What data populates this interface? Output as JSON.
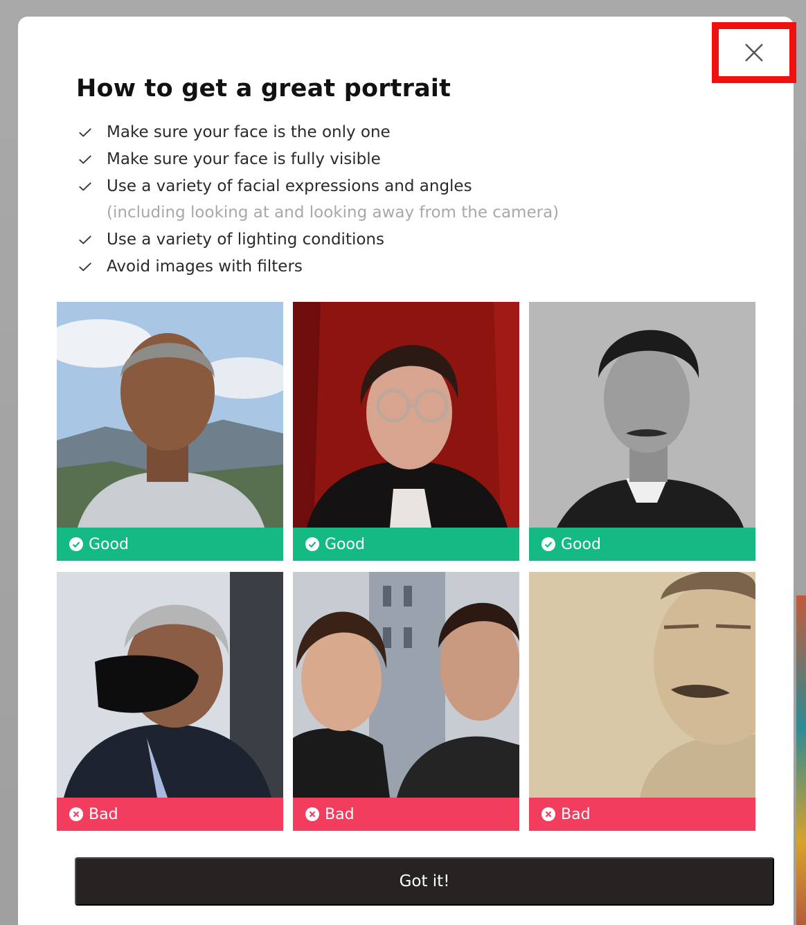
{
  "modal": {
    "title": "How to get a great portrait",
    "close_icon": "close-icon",
    "tips": [
      {
        "text": "Make sure your face is the only one"
      },
      {
        "text": "Make sure your face is fully visible"
      },
      {
        "text": "Use a variety of facial expressions and angles",
        "sub": "(including looking at and looking away from the camera)"
      },
      {
        "text": "Use a variety of lighting conditions"
      },
      {
        "text": "Avoid images with filters"
      }
    ],
    "examples": [
      {
        "label": "Good",
        "status": "good",
        "photo": "portrait-outdoor-mountains"
      },
      {
        "label": "Good",
        "status": "good",
        "photo": "portrait-red-curtain-glasses"
      },
      {
        "label": "Good",
        "status": "good",
        "photo": "portrait-black-and-white-vintage"
      },
      {
        "label": "Bad",
        "status": "bad",
        "photo": "portrait-face-mask"
      },
      {
        "label": "Bad",
        "status": "bad",
        "photo": "portrait-two-faces"
      },
      {
        "label": "Bad",
        "status": "bad",
        "photo": "portrait-cropped-sepia"
      }
    ],
    "confirm_label": "Got it!"
  },
  "colors": {
    "good": "#14b983",
    "bad": "#f23d5f",
    "button": "#262322",
    "highlight": "#f01010"
  }
}
